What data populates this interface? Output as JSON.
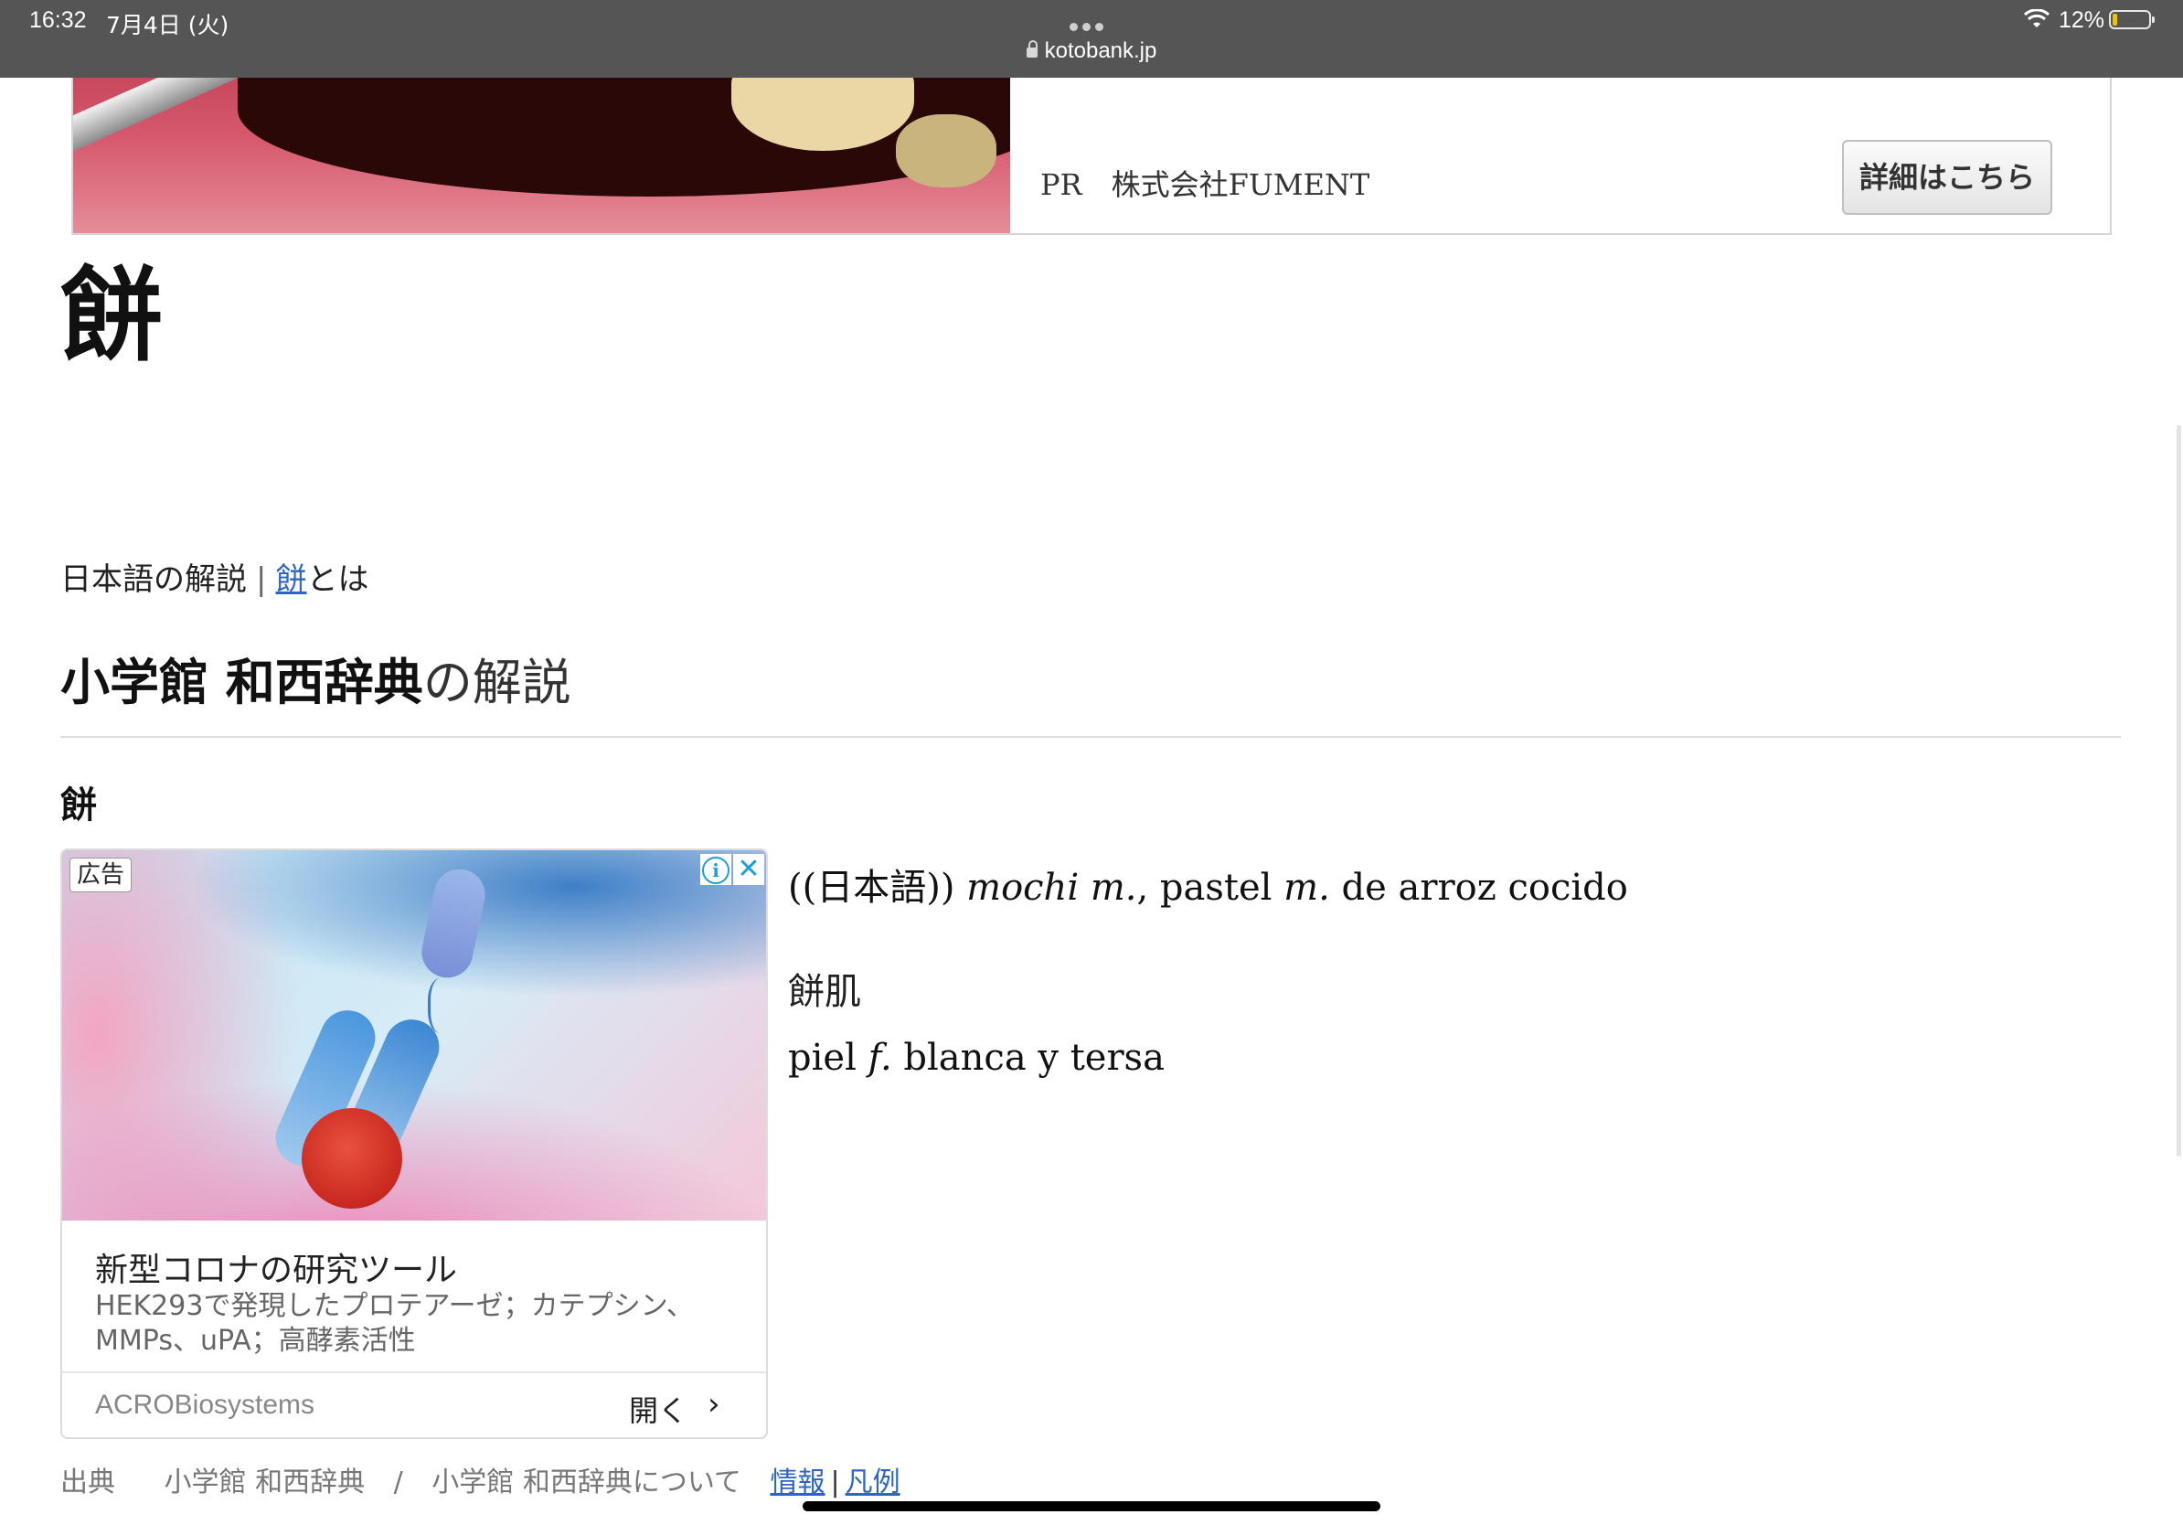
{
  "status_bar": {
    "time": "16:32",
    "date": "7月4日 (火)",
    "url": "kotobank.jp",
    "battery_percent": "12%",
    "battery_level": 0.12
  },
  "top_ad": {
    "sponsor": "PR　株式会社FUMENT",
    "detail_button": "詳細はこちら"
  },
  "page": {
    "word_title": "餅",
    "breadcrumb": {
      "prefix": "日本語の解説",
      "separator": "|",
      "link": "餅",
      "suffix": "とは"
    },
    "source_heading": {
      "name": "小学館 和西辞典",
      "suffix": "の解説"
    },
    "entry_headword": "餅"
  },
  "inline_ad": {
    "label": "広告",
    "headline": "新型コロナの研究ツール",
    "body": "HEK293で発現したプロテアーゼ；カテプシン、MMPs、uPA；高酵素活性",
    "advertiser": "ACROBiosystems",
    "open_button": "開く"
  },
  "definition": {
    "tag": "((日本語))",
    "term1": "mochi",
    "gender1": "m.",
    "sep": ", pastel",
    "gender2": "m.",
    "rest": "de arroz cocido",
    "subentry_word": "餅肌",
    "subentry_pre": "piel",
    "subentry_gender": "f.",
    "subentry_post": "blanca y tersa"
  },
  "footer": {
    "source_label": "出典",
    "source_name": "小学館 和西辞典",
    "slash": "/",
    "about": "小学館 和西辞典について",
    "info_link": "情報",
    "bar": "|",
    "legend_link": "凡例"
  },
  "colors": {
    "status_bar_bg": "#555555",
    "link": "#2b66c6",
    "battery": "#f2c200"
  }
}
